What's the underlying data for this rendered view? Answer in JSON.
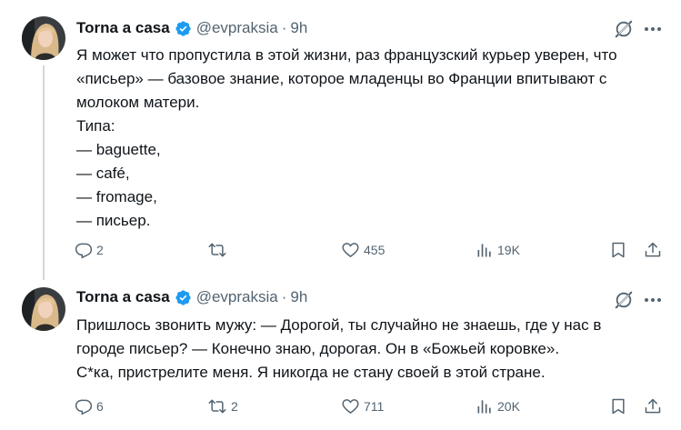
{
  "colors": {
    "text": "#0f1419",
    "secondary": "#536471",
    "verified": "#1d9bf0",
    "thread_line": "#cfd9de"
  },
  "tweets": [
    {
      "author_name": "Torna a casa",
      "handle": "@evpraksia",
      "separator": "·",
      "time": "9h",
      "lines": [
        "Я может что пропустила в этой жизни, раз французский курьер уверен, что",
        "«письер» — базовое знание, которое младенцы во Франции впитывают с",
        "молоком матери.",
        "Типа:",
        "— baguette,",
        "— café,",
        "— fromage,",
        "— письер."
      ],
      "replies": "2",
      "reposts": "",
      "likes": "455",
      "views": "19K"
    },
    {
      "author_name": "Torna a casa",
      "handle": "@evpraksia",
      "separator": "·",
      "time": "9h",
      "lines": [
        "Пришлось звонить мужу: — Дорогой, ты случайно не знаешь, где у нас в",
        "городе письер? — Конечно знаю, дорогая. Он в «Божьей коровке».",
        "С*ка, пристрелите меня. Я никогда не стану своей в этой стране."
      ],
      "replies": "6",
      "reposts": "2",
      "likes": "711",
      "views": "20K"
    }
  ],
  "icons": {
    "verified": "verified-badge-icon",
    "grok": "grok-icon",
    "more": "more-options-icon",
    "reply": "reply-icon",
    "repost": "repost-icon",
    "like": "like-icon",
    "views": "views-icon",
    "bookmark": "bookmark-icon",
    "share": "share-icon"
  }
}
